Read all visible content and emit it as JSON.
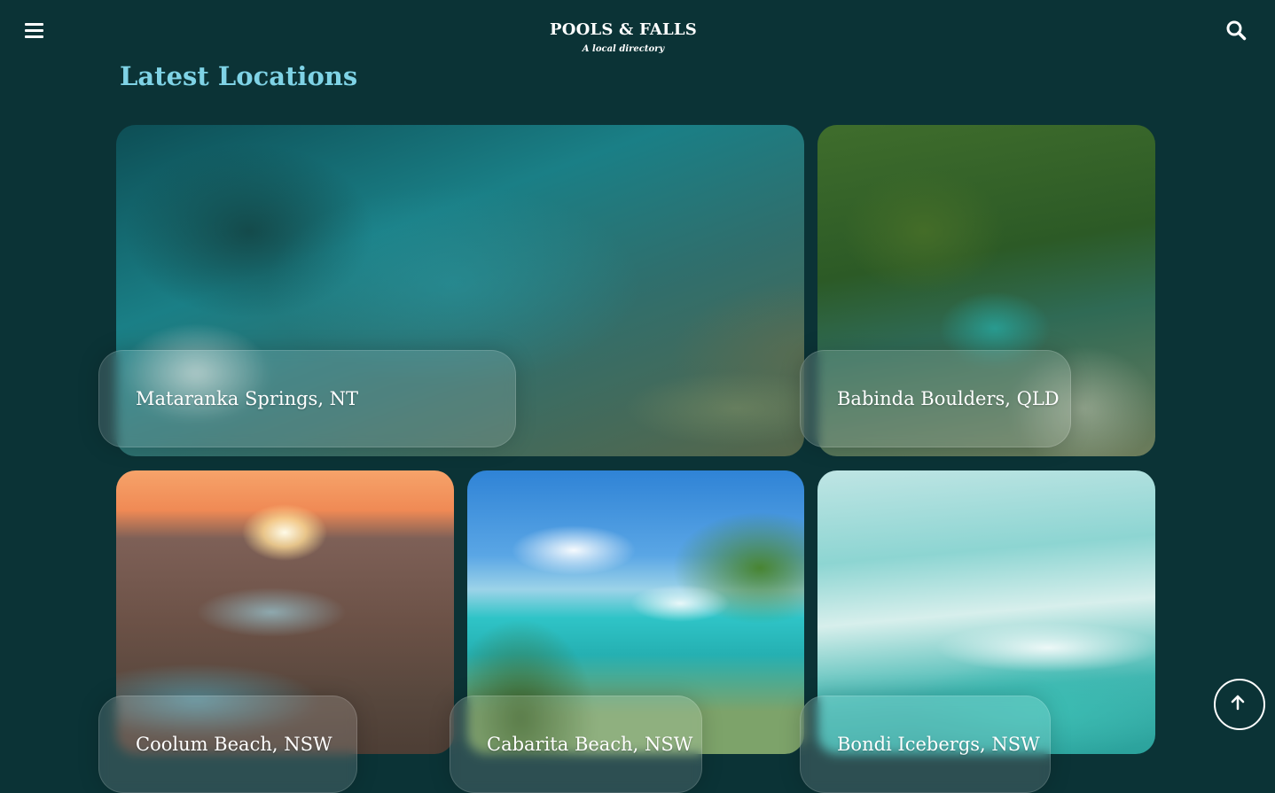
{
  "header": {
    "logo_title": "POOLS & FALLS",
    "logo_subtitle": "A local directory",
    "menu_icon": "hamburger-menu-icon",
    "search_icon": "search-icon"
  },
  "main": {
    "heading": "Latest Locations",
    "heading_color": "#7fd3e6",
    "locations": [
      {
        "name": "Mataranka Springs, NT"
      },
      {
        "name": "Babinda Boulders, QLD"
      },
      {
        "name": "Coolum Beach, NSW"
      },
      {
        "name": "Cabarita Beach, NSW"
      },
      {
        "name": "Bondi Icebergs, NSW"
      }
    ]
  },
  "scroll_top_icon": "arrow-up-icon",
  "colors": {
    "background": "#0b3336",
    "text": "#ffffff"
  }
}
